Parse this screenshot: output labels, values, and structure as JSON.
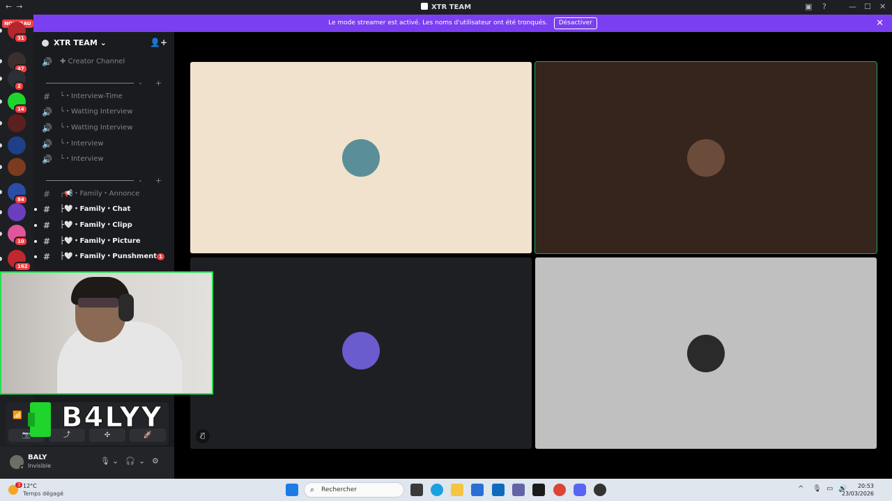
{
  "titlebar": {
    "title": "XTR TEAM",
    "back": "←",
    "forward": "→",
    "min": "—",
    "max": "☐",
    "close": "✕"
  },
  "banner": {
    "message": "Le mode streamer est activé. Les noms d'utilisateur ont été tronqués.",
    "button": "Désactiver",
    "close": "✕"
  },
  "rail": {
    "new_label": "NOUVEAU",
    "servers": [
      {
        "badge": "31",
        "color": "#b3262b"
      },
      {
        "badge": "47",
        "color": "#3b2f2f"
      },
      {
        "badge": "2",
        "color": "#2c2f33"
      },
      {
        "badge": "14",
        "color": "#1ed42d"
      },
      {
        "badge": "",
        "color": "#5c1f1f"
      },
      {
        "badge": "",
        "color": "#1f3f8a"
      },
      {
        "badge": "",
        "color": "#7a3b1f"
      },
      {
        "badge": "84",
        "color": "#2a4ea8"
      },
      {
        "badge": "",
        "color": "#6a3fbf"
      },
      {
        "badge": "10",
        "color": "#e0569a"
      },
      {
        "badge": "162",
        "color": "#c0282d"
      }
    ]
  },
  "sidebar": {
    "guild_name": "XTR TEAM",
    "guild_chevron": "⌄",
    "invite_icon": "👤+",
    "channels": [
      {
        "icon": "🔊",
        "label": "✚ Creator Channel",
        "bold": false,
        "unread": ""
      },
      {
        "icon": "#",
        "label": "└・Interview-Time",
        "bold": false,
        "unread": ""
      },
      {
        "icon": "🔊",
        "label": "└・Watting Interview",
        "bold": false,
        "unread": ""
      },
      {
        "icon": "🔊",
        "label": "└・Watting Interview",
        "bold": false,
        "unread": ""
      },
      {
        "icon": "🔊",
        "label": "└・Interview",
        "bold": false,
        "unread": ""
      },
      {
        "icon": "🔊",
        "label": "└・Interview",
        "bold": false,
        "unread": ""
      },
      {
        "icon": "#",
        "label": "┌📢・Family・Annonce",
        "bold": false,
        "unread": ""
      },
      {
        "icon": "#",
        "label": "├🤍・Family・Chat",
        "bold": true,
        "unread": ""
      },
      {
        "icon": "#",
        "label": "├🤍・Family・Clipp",
        "bold": true,
        "unread": ""
      },
      {
        "icon": "#",
        "label": "├🤍・Family・Picture",
        "bold": true,
        "unread": ""
      },
      {
        "icon": "#",
        "label": "├🤍・Family・Punshment",
        "bold": true,
        "unread": "1"
      }
    ],
    "divider_chevron": "⌄",
    "divider_plus": "+"
  },
  "brand": {
    "text": "B4LYY"
  },
  "voice": {
    "buttons": [
      "📷",
      "⤴",
      "✣",
      "🚀"
    ]
  },
  "user": {
    "name": "BALY",
    "status": "Invisible",
    "mic_icon": "🎙",
    "headset_icon": "🎧",
    "settings_icon": "⚙",
    "chevron": "⌄"
  },
  "tiles": [
    {
      "bg": "#f0e2cc",
      "avatar": "#5a8f99",
      "speaking": false
    },
    {
      "bg": "#36251d",
      "avatar": "#6b4b3a",
      "speaking": true
    },
    {
      "bg": "#1e1f22",
      "avatar": "#6a5bcf",
      "speaking": false
    },
    {
      "bg": "#c0c0c0",
      "avatar": "#2a2a2a",
      "speaking": false
    }
  ],
  "tile_mute_icon": "🎙̸",
  "taskbar": {
    "weather_badge": "3",
    "temp": "12°C",
    "weather": "Temps dégagé",
    "search_placeholder": "Rechercher",
    "time": "20:53",
    "date": "23/03/2026",
    "tray": [
      "^",
      "🎙",
      "▭",
      "🔊"
    ]
  },
  "colors": {
    "accent": "#7a3ff0",
    "speaking": "#23a55a",
    "cam_border": "#23e052"
  }
}
